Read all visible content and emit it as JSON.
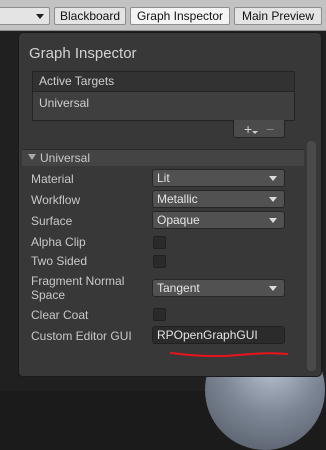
{
  "toolbar": {
    "buttons": [
      {
        "label": "Blackboard",
        "active": false
      },
      {
        "label": "Graph Inspector",
        "active": true
      },
      {
        "label": "Main Preview",
        "active": false
      }
    ]
  },
  "inspector": {
    "title": "Graph Inspector",
    "active_targets": {
      "header": "Active Targets",
      "items": [
        "Universal"
      ],
      "add_label": "+",
      "remove_label": "−"
    },
    "section": {
      "title": "Universal",
      "properties": {
        "material": {
          "label": "Material",
          "value": "Lit"
        },
        "workflow": {
          "label": "Workflow",
          "value": "Metallic"
        },
        "surface": {
          "label": "Surface",
          "value": "Opaque"
        },
        "alpha_clip": {
          "label": "Alpha Clip",
          "checked": false
        },
        "two_sided": {
          "label": "Two Sided",
          "checked": false
        },
        "fragment_normal_space": {
          "label": "Fragment Normal Space",
          "value": "Tangent"
        },
        "clear_coat": {
          "label": "Clear Coat",
          "checked": false
        },
        "custom_editor_gui": {
          "label": "Custom Editor GUI",
          "value": "RPOpenGraphGUI"
        }
      }
    }
  },
  "colors": {
    "annotation_underline": "#e8141c",
    "panel_background": "#383838"
  }
}
